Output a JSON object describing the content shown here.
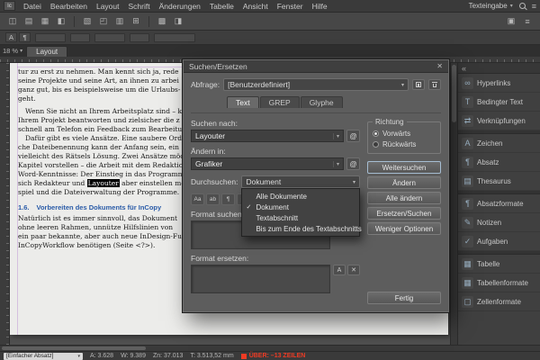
{
  "icons": {
    "close": "✕",
    "chevron_down": "▾",
    "hamburger": "≡",
    "collapse": "«",
    "check": "✓"
  },
  "app": {
    "icon_label": "Ic",
    "menu_items": [
      "Datei",
      "Bearbeiten",
      "Layout",
      "Schrift",
      "Änderungen",
      "Tabelle",
      "Ansicht",
      "Fenster",
      "Hilfe"
    ],
    "workspace": "Texteingabe"
  },
  "toolbar": {
    "icons": [
      "◫",
      "▤",
      "▦",
      "◧",
      "▧",
      "◰",
      "▥",
      "⊞",
      "▩",
      "◨"
    ],
    "right_icons": [
      "▣",
      "≡"
    ]
  },
  "controlbar": {
    "mode_icons": [
      "A",
      "¶"
    ]
  },
  "tabs": {
    "zoom": "18 %",
    "active": "Layout"
  },
  "document": {
    "lines": [
      {
        "text": "tur zu erst zu nehmen. Man kennt sich ja, rede"
      },
      {
        "text": "seine Projekte und seine Art, an ihnen zu arbei"
      },
      {
        "text": "ganz gut, bis es beispielsweise um die Urlaubs-"
      },
      {
        "text": "geht."
      },
      {
        "gap": true
      },
      {
        "text": "Wenn Sie nicht an Ihrem Arbeitsplatz sind – k",
        "indent": true
      },
      {
        "text": "Ihrem Projekt beantworten und zielsicher die z"
      },
      {
        "text": "schnell am Telefon ein Feedback zum Bearbeitun"
      },
      {
        "text": "Dafür gibt es viele Ansätze. Eine saubere Ord",
        "indent": true
      },
      {
        "text": "che Dateibenennung kann der Anfang sein, ein"
      },
      {
        "text": "vielleicht des Rätsels Lösung. Zwei Ansätze möc"
      },
      {
        "text": "Kapitel vorstellen – die Arbeit mit dem Redaktion"
      },
      {
        "text": "Word-Kenntnisse: Der Einstieg in das Programm"
      },
      {
        "pre": "sich Redakteur und ",
        "mark": "Layouter",
        "post": " aber einstellen mö"
      },
      {
        "text": "spiel und die Dateiverwaltung der Programme."
      },
      {
        "gap": true
      },
      {
        "heading": true,
        "num": "1.6.",
        "text": "Vorbereiten des Dokuments für InCopy"
      },
      {
        "text": "Natürlich ist es immer sinnvoll, das Dokument"
      },
      {
        "text": "ohne leeren Rahmen, unnütze Hilfslinien von"
      },
      {
        "text": "ein paar bekannte, aber auch neue InDesign-Fu"
      },
      {
        "text": "InCopyWorkflow benötigen (Seite <?>)."
      }
    ]
  },
  "dialog": {
    "title": "Suchen/Ersetzen",
    "query_label": "Abfrage:",
    "query_value": "[Benutzerdefiniert]",
    "tabs": [
      "Text",
      "GREP",
      "Glyphe"
    ],
    "active_tab": "Text",
    "find_label": "Suchen nach:",
    "find_value": "Layouter",
    "change_label": "Ändern in:",
    "change_value": "Grafiker",
    "search_label": "Durchsuchen:",
    "search_value": "Dokument",
    "scope_menu": [
      {
        "label": "Alle Dokumente"
      },
      {
        "label": "Dokument",
        "checked": true
      },
      {
        "label": "Textabschnitt"
      },
      {
        "label": "Bis zum Ende des Textabschnitts"
      }
    ],
    "search_options": [
      "Aa",
      "ab",
      "¶",
      "◪",
      "▣",
      "Ω",
      "@"
    ],
    "at_glyph": "@",
    "format_find_label": "Format suchen:",
    "format_change_label": "Format ersetzen:",
    "format_buttons": [
      "A",
      "✕"
    ],
    "direction": {
      "legend": "Richtung",
      "options": [
        {
          "label": "Vorwärts",
          "selected": true
        },
        {
          "label": "Rückwärts",
          "selected": false
        }
      ]
    },
    "buttons": [
      "Weitersuchen",
      "Ändern",
      "Alle ändern",
      "Ersetzen/Suchen",
      "Weniger Optionen"
    ],
    "done_label": "Fertig"
  },
  "panels": {
    "group_breaks": [
      2,
      5,
      8
    ],
    "items": [
      {
        "icon": "∞",
        "label": "Hyperlinks"
      },
      {
        "icon": "T",
        "label": "Bedingter Text"
      },
      {
        "icon": "⇄",
        "label": "Verknüpfungen"
      },
      {
        "icon": "A",
        "label": "Zeichen"
      },
      {
        "icon": "¶",
        "label": "Absatz"
      },
      {
        "icon": "▤",
        "label": "Thesaurus"
      },
      {
        "icon": "¶",
        "label": "Absatzformate"
      },
      {
        "icon": "✎",
        "label": "Notizen"
      },
      {
        "icon": "✓",
        "label": "Aufgaben"
      },
      {
        "icon": "▦",
        "label": "Tabelle"
      },
      {
        "icon": "▦",
        "label": "Tabellenformate"
      },
      {
        "icon": "▢",
        "label": "Zellenformate"
      }
    ]
  },
  "statusbar": {
    "style_box": "[Einfacher Absatz]",
    "stats": [
      "A: 3.628",
      "W: 9.389",
      "Zn: 37.013",
      "T: 3.513,52 mm"
    ],
    "overset": "ÜBER: –13 ZEILEN"
  }
}
